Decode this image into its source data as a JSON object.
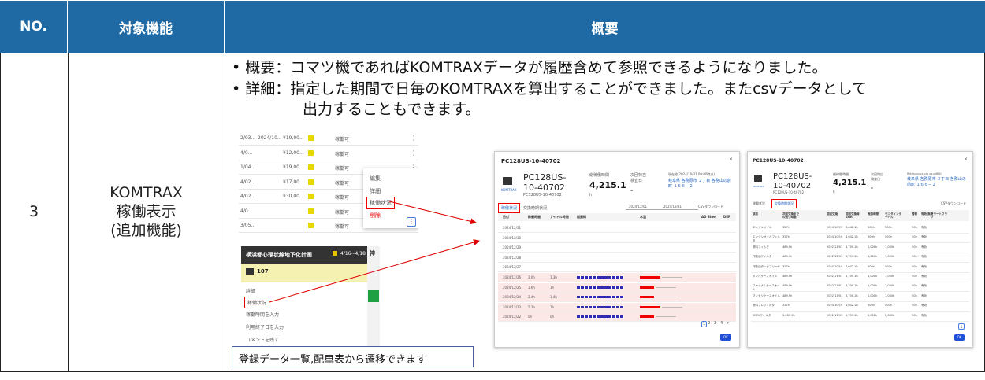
{
  "header": {
    "no": "NO.",
    "feature": "対象機能",
    "summary": "概要"
  },
  "row": {
    "no": "3",
    "feature_lines": [
      "KOMTRAX",
      "稼働表示",
      "(追加機能)"
    ],
    "bullets": [
      "• 概要：コマツ機であればKOMTRAXデータが履歴含めて参照できるようになりました。",
      "• 詳細：指定した期間で日毎のKOMTRAXを算出することができました。またcsvデータとして",
      "出力することもできます。"
    ],
    "caption": "登録データ一覧,配車表から遷移できます"
  },
  "list_panel": {
    "rows": [
      {
        "a": "2/03...",
        "b": "2024/10...",
        "c": "¥19,00...",
        "d": "稼働可"
      },
      {
        "a": "4/0...",
        "b": "",
        "c": "¥12,00...",
        "d": "稼働可"
      },
      {
        "a": "1/04...",
        "b": "",
        "c": "¥19,00...",
        "d": "稼働可"
      },
      {
        "a": "4/02...",
        "b": "",
        "c": "¥17,00...",
        "d": "稼働可"
      },
      {
        "a": "4/02...",
        "b": "",
        "c": "¥30,00...",
        "d": "稼働可"
      },
      {
        "a": "4/0...",
        "b": "",
        "c": "",
        "d": "稼働可"
      },
      {
        "a": "3/05...",
        "b": "",
        "c": "",
        "d": "稼働可"
      }
    ],
    "menu": [
      "編集",
      "詳細",
      "稼働状況",
      "削除"
    ]
  },
  "schedule_panel": {
    "title": "横浜都心環状線地下化計画",
    "dates": "4/16~4/18",
    "col_label": "神",
    "machine": "107",
    "menu": [
      "詳細",
      "稼働状況",
      "稼働時間を入力",
      "利用終了日を入力",
      "コメントを残す"
    ]
  },
  "detail_panel": {
    "title": "PC128US-10-40702",
    "model": "PC128US-",
    "model2": "10-40702",
    "model_sub": "PC128US-10-40702",
    "brand": "KOMTRAX",
    "total_label": "総稼働時間",
    "total_value": "4,215.1",
    "total_unit": "h",
    "next_label": "次回特自\n検査日",
    "next_value": "-",
    "loc_label": "現在地(2024/10/31 09:00時点)",
    "loc_value": "岐阜県 各務原市 ２丁目 各務山の前町 １６６－２",
    "tabs": [
      "稼働状況",
      "交換時期状況"
    ],
    "date_from": "2024/12/01",
    "date_to": "2024/12/31",
    "csv": "CSVダウンロード",
    "cols": [
      "日付",
      "稼働時間",
      "アイドル時間",
      "燃費料",
      "水温",
      "AD Blue",
      "DEF"
    ],
    "dates": [
      "2024/12/31",
      "2024/12/30",
      "2024/12/29",
      "2024/12/28",
      "2024/12/27",
      "2024/12/26",
      "2024/12/25",
      "2024/12/24",
      "2024/12/23",
      "2024/12/22"
    ],
    "hours": [
      "",
      "",
      "",
      "",
      "",
      "2.0h",
      "1.6h",
      "2.4h",
      "5.3h",
      "0h"
    ],
    "idle": [
      "",
      "",
      "",
      "",
      "",
      "1.3h",
      "1h",
      "1.4h",
      "1h",
      "0h"
    ],
    "pages": [
      "1",
      "2",
      "3",
      "4",
      ">"
    ],
    "ok": "OK"
  },
  "parts_panel": {
    "title": "PC128US-10-40702",
    "model": "PC128US-",
    "model2": "10-40702",
    "model_sub": "PC128US-10-40702",
    "brand": "KOMTRAX",
    "total_label": "総稼働時間",
    "total_value": "4,215.1",
    "total_unit": "h",
    "next_label": "次回特自\n検査日",
    "next_value": "-",
    "loc_label": "現在地(2024/10/31 09:00時点)",
    "loc_value": "岐阜県 各務原市 ２丁目 各務山の前町 １６６－２",
    "tabs": [
      "稼働状況",
      "交換時期状況"
    ],
    "csv": "CSVダウンロード",
    "cols": [
      "項目",
      "次回交換までの残り時間",
      "前回交換",
      "前回交換時SMR",
      "推奨時間",
      "モニタインターバル",
      "警報",
      "有効/無効",
      "アラートフラグ"
    ],
    "items": [
      {
        "name": "エンジンオイル",
        "rem": "327h",
        "last": "2024/10/19",
        "smr": "4,042.1h",
        "rec": "500h",
        "mon": "500h",
        "al": "50h",
        "st": "有効"
      },
      {
        "name": "エンジンオイルフィルタ",
        "rem": "327h",
        "last": "2024/10/19",
        "smr": "4,042.1h",
        "rec": "500h",
        "mon": "500h",
        "al": "50h",
        "st": "有効"
      },
      {
        "name": "燃料フィルタ",
        "rem": "489.9h",
        "last": "2022/11/01",
        "smr": "3,705.1h",
        "rec": "1,000h",
        "mon": "1,000h",
        "al": "50h",
        "st": "有効"
      },
      {
        "name": "作動油フィルタ",
        "rem": "489.9h",
        "last": "2022/11/01",
        "smr": "3,705.1h",
        "rec": "1,000h",
        "mon": "1,000h",
        "al": "50h",
        "st": "有効"
      },
      {
        "name": "作動油タンクブリーザ",
        "rem": "327h",
        "last": "2024/10/19",
        "smr": "4,042.1h",
        "rec": "500h",
        "mon": "500h",
        "al": "50h",
        "st": "有効"
      },
      {
        "name": "ダンパケースオイル",
        "rem": "489.9h",
        "last": "2022/11/01",
        "smr": "3,705.1h",
        "rec": "1,000h",
        "mon": "1,000h",
        "al": "50h",
        "st": "有効"
      },
      {
        "name": "ファイナルケースオイル",
        "rem": "489.9h",
        "last": "2022/11/01",
        "smr": "3,705.1h",
        "rec": "1,000h",
        "mon": "1,000h",
        "al": "50h",
        "st": "有効"
      },
      {
        "name": "マシナリケースオイル",
        "rem": "489.9h",
        "last": "2022/11/01",
        "smr": "3,705.1h",
        "rec": "1,000h",
        "mon": "1,000h",
        "al": "50h",
        "st": "有効"
      },
      {
        "name": "燃料プレフィルタ",
        "rem": "327h",
        "last": "2024/10/19",
        "smr": "4,042.1h",
        "rec": "500h",
        "mon": "500h",
        "al": "50h",
        "st": "有効"
      },
      {
        "name": "KCCVフィルタ",
        "rem": "1,489.9h",
        "last": "2022/11/01",
        "smr": "3,705.1h",
        "rec": "2,000h",
        "mon": "2,000h",
        "al": "50h",
        "st": "有効"
      }
    ],
    "ok": "OK"
  },
  "colors": {
    "header_bg": "#1f6aa5",
    "annotation_red": "#e00000",
    "accent_blue": "#1f5fbf",
    "yellow": "#e8d800"
  }
}
